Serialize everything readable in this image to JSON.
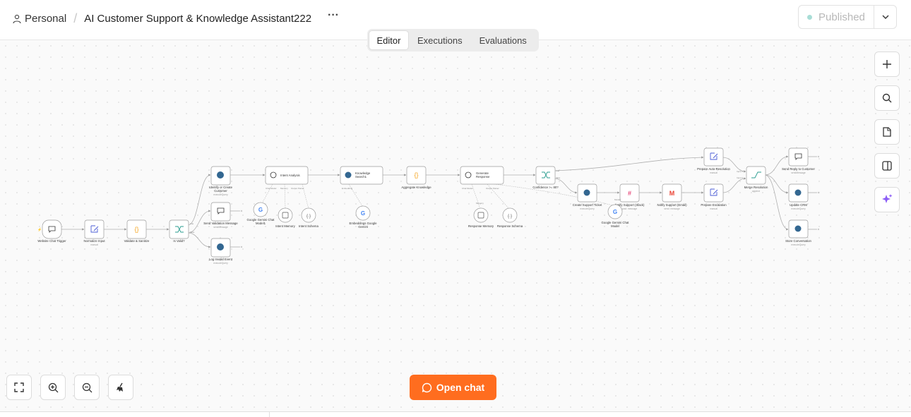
{
  "header": {
    "workspace": "Personal",
    "workflow_title": "AI Customer Support & Knowledge Assistant222",
    "more_icon": "more-horizontal-icon",
    "status_label": "Published",
    "status_color": "#a8ddd6"
  },
  "tabs": [
    {
      "label": "Editor",
      "active": true
    },
    {
      "label": "Executions",
      "active": false
    },
    {
      "label": "Evaluations",
      "active": false
    }
  ],
  "right_toolbar": [
    {
      "name": "add-node-button",
      "icon": "plus-icon"
    },
    {
      "name": "search-nodes-button",
      "icon": "search-icon"
    },
    {
      "name": "sticky-note-button",
      "icon": "sticky-note-icon"
    },
    {
      "name": "toggle-panel-button",
      "icon": "panel-icon"
    },
    {
      "name": "ai-assistant-button",
      "icon": "sparkle-icon"
    }
  ],
  "bottom_toolbar": [
    {
      "name": "fit-view-button",
      "icon": "fullscreen-icon"
    },
    {
      "name": "zoom-in-button",
      "icon": "zoom-in-icon"
    },
    {
      "name": "zoom-out-button",
      "icon": "zoom-out-icon"
    },
    {
      "name": "tidy-up-button",
      "icon": "broom-icon"
    }
  ],
  "open_chat": {
    "label": "Open chat",
    "icon": "chat-bubble-icon",
    "color": "#ff6d1f"
  },
  "nodes": {
    "website_chat_trigger": {
      "label": "Website Chat Trigger"
    },
    "normalize_input": {
      "label": "Normalize Input",
      "sub": "manual"
    },
    "validate_sanitize": {
      "label": "Validate & Sanitize"
    },
    "is_valid": {
      "label": "Is Valid?"
    },
    "identify_customer": {
      "label1": "Identify or Create",
      "label2": "Customer",
      "sub": "executeQuery"
    },
    "send_validation": {
      "label": "Send Validation Message",
      "sub": "sendMessage"
    },
    "log_invalid": {
      "label": "Log Invalid Event",
      "sub": "executeQuery"
    },
    "intent_analysis": {
      "label": "Intent Analysis"
    },
    "gemini_chat_1": {
      "label1": "Google Gemini Chat",
      "label2": "Model1"
    },
    "intent_memory": {
      "label": "Intent Memory"
    },
    "intent_schema": {
      "label": "Intent Schema"
    },
    "knowledge_search": {
      "label1": "Knowledge",
      "label2": "Search1"
    },
    "embeddings": {
      "label1": "Embeddings Google",
      "label2": "Gemini"
    },
    "aggregate_knowledge": {
      "label": "Aggregate Knowledge"
    },
    "generate_response": {
      "label1": "Generate",
      "label2": "Response"
    },
    "response_memory": {
      "label": "Response Memory"
    },
    "response_schema": {
      "label": "Response Schema"
    },
    "confidence": {
      "label": "Confidence >= 80?"
    },
    "create_ticket": {
      "label": "Create Support Ticket",
      "sub": "executeQuery"
    },
    "gemini_chat_2": {
      "label1": "Google Gemini Chat",
      "label2": "Model"
    },
    "notify_slack": {
      "label": "Notify Support (Slack)",
      "sub": "post: message"
    },
    "notify_email": {
      "label": "Notify Support (Email)",
      "sub": "send: message"
    },
    "prepare_escalation": {
      "label": "Prepare Escalation",
      "sub": "manual"
    },
    "prepare_auto": {
      "label": "Prepare Auto-Resolution",
      "sub": "manual"
    },
    "merge_resolution": {
      "label": "Merge Resolution",
      "sub": "append"
    },
    "send_reply": {
      "label": "Send Reply to Customer",
      "sub": "sendMessage"
    },
    "update_crm": {
      "label": "Update CRM",
      "sub": "executeQuery"
    },
    "store_conversation": {
      "label": "Store Conversation",
      "sub": "executeQuery"
    }
  },
  "ports": {
    "true": "true",
    "false": "false",
    "chat_model": "Chat Model",
    "model": "Model*",
    "memory": "Memory",
    "output_parser": "Output Parser",
    "embedding": "Embedding",
    "input1": "Input 1",
    "input2": "Input 2"
  }
}
